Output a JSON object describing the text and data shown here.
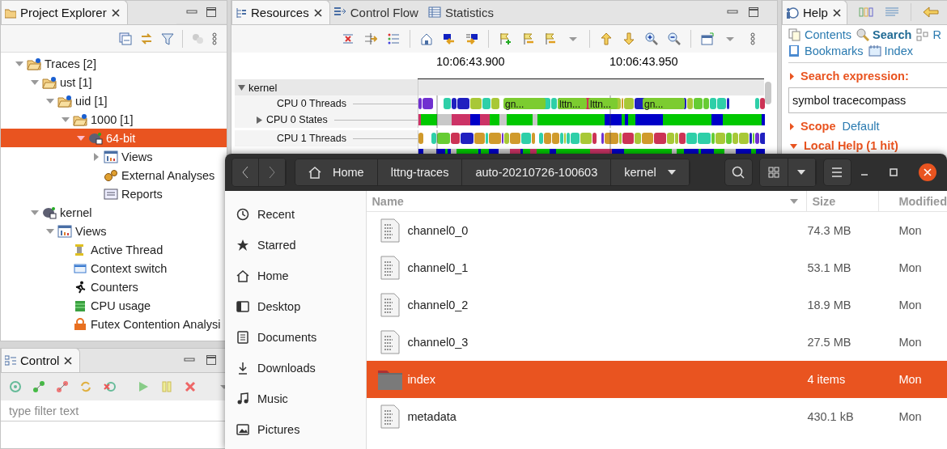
{
  "project_explorer": {
    "tab": "Project Explorer",
    "tree": [
      {
        "label": "Traces [2]",
        "kind": "folder",
        "expanded": true,
        "selected": false,
        "children": [
          {
            "label": "ust [1]",
            "kind": "folder",
            "expanded": true,
            "selected": false,
            "children": [
              {
                "label": "uid [1]",
                "kind": "folder",
                "expanded": true,
                "selected": false,
                "children": [
                  {
                    "label": "1000 [1]",
                    "kind": "folder",
                    "expanded": true,
                    "selected": false,
                    "children": [
                      {
                        "label": "64-bit",
                        "kind": "trace",
                        "expanded": true,
                        "selected": true,
                        "children": [
                          {
                            "label": "Views",
                            "kind": "views",
                            "expanded": false,
                            "selected": false
                          },
                          {
                            "label": "External Analyses",
                            "kind": "gears",
                            "selected": false
                          },
                          {
                            "label": "Reports",
                            "kind": "report",
                            "selected": false
                          }
                        ]
                      }
                    ]
                  }
                ]
              }
            ]
          },
          {
            "label": "kernel",
            "kind": "trace",
            "expanded": true,
            "selected": false,
            "children": [
              {
                "label": "Views",
                "kind": "views",
                "expanded": true,
                "selected": false,
                "children": [
                  {
                    "label": "Active Thread",
                    "kind": "thread",
                    "selected": false
                  },
                  {
                    "label": "Context switch",
                    "kind": "context",
                    "selected": false
                  },
                  {
                    "label": "Counters",
                    "kind": "counters",
                    "selected": false
                  },
                  {
                    "label": "CPU usage",
                    "kind": "cpu",
                    "selected": false
                  },
                  {
                    "label": "Futex Contention Analysi",
                    "kind": "futex",
                    "selected": false
                  }
                ]
              }
            ]
          }
        ]
      }
    ]
  },
  "control": {
    "tab": "Control",
    "filter": {
      "placeholder": "type filter text"
    }
  },
  "resources": {
    "tabs": [
      {
        "label": "Resources",
        "kind": "resources",
        "selected": true
      },
      {
        "label": "Control Flow",
        "kind": "flow",
        "selected": false
      },
      {
        "label": "Statistics",
        "kind": "stats",
        "selected": false
      }
    ],
    "time_ticks": [
      "10:06:43.900",
      "10:06:43.950"
    ],
    "rows": [
      {
        "label": "kernel",
        "kind": "group",
        "expanded": true
      },
      {
        "label": "CPU 0 Threads",
        "kind": "threads",
        "bar_labels": [
          "gn...",
          "lttn...",
          "lttn...",
          "gn..."
        ]
      },
      {
        "label": "CPU 0 States",
        "kind": "states",
        "expanded": false
      },
      {
        "label": "CPU 1 Threads",
        "kind": "threads"
      },
      {
        "kind": "states"
      }
    ]
  },
  "help": {
    "tab": "Help",
    "links": [
      {
        "label": "Contents",
        "kind": "contents",
        "selected": false
      },
      {
        "label": "Search",
        "kind": "search",
        "selected": true
      },
      {
        "label": "R",
        "kind": "related",
        "selected": false
      },
      {
        "label": "Bookmarks",
        "kind": "bookmarks",
        "selected": false
      },
      {
        "label": "Index",
        "kind": "index",
        "selected": false
      }
    ],
    "search_title": "Search expression:",
    "search_value": "symbol tracecompass",
    "scope_label": "Scope",
    "scope_value": "Default",
    "results_title": "Local Help (1 hit)"
  },
  "file_manager": {
    "path": [
      "Home",
      "lttng-traces",
      "auto-20210726-100603",
      "kernel"
    ],
    "sidebar": [
      {
        "label": "Recent",
        "kind": "recent",
        "selected": false
      },
      {
        "label": "Starred",
        "kind": "starred",
        "selected": false
      },
      {
        "label": "Home",
        "kind": "home",
        "selected": false
      },
      {
        "label": "Desktop",
        "kind": "desktop",
        "selected": false
      },
      {
        "label": "Documents",
        "kind": "documents",
        "selected": false
      },
      {
        "label": "Downloads",
        "kind": "downloads",
        "selected": false
      },
      {
        "label": "Music",
        "kind": "music",
        "selected": false
      },
      {
        "label": "Pictures",
        "kind": "pictures",
        "selected": false
      }
    ],
    "columns": [
      "Name",
      "Size",
      "Modified"
    ],
    "files": [
      {
        "name": "channel0_0",
        "size": "74.3 MB",
        "modified": "Mon",
        "kind": "file",
        "selected": false
      },
      {
        "name": "channel0_1",
        "size": "53.1 MB",
        "modified": "Mon",
        "kind": "file",
        "selected": false
      },
      {
        "name": "channel0_2",
        "size": "18.9 MB",
        "modified": "Mon",
        "kind": "file",
        "selected": false
      },
      {
        "name": "channel0_3",
        "size": "27.5 MB",
        "modified": "Mon",
        "kind": "file",
        "selected": false
      },
      {
        "name": "index",
        "size": "4 items",
        "modified": "Mon",
        "kind": "folder",
        "selected": true
      },
      {
        "name": "metadata",
        "size": "430.1 kB",
        "modified": "Mon",
        "kind": "file",
        "selected": false
      }
    ]
  }
}
